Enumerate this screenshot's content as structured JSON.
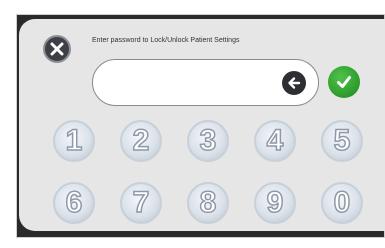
{
  "prompt": "Enter password to Lock/Unlock Patient Settings",
  "password_field": {
    "value": ""
  },
  "colors": {
    "confirm": "#2c9a2a",
    "close": "#3d4147",
    "key_digit_outline": "#8e99a6"
  },
  "icons": {
    "close": "close-icon",
    "backspace": "backspace-arrow-icon",
    "confirm": "checkmark-icon"
  },
  "keypad": {
    "row1": [
      "1",
      "2",
      "3",
      "4",
      "5"
    ],
    "row2": [
      "6",
      "7",
      "8",
      "9",
      "0"
    ]
  }
}
